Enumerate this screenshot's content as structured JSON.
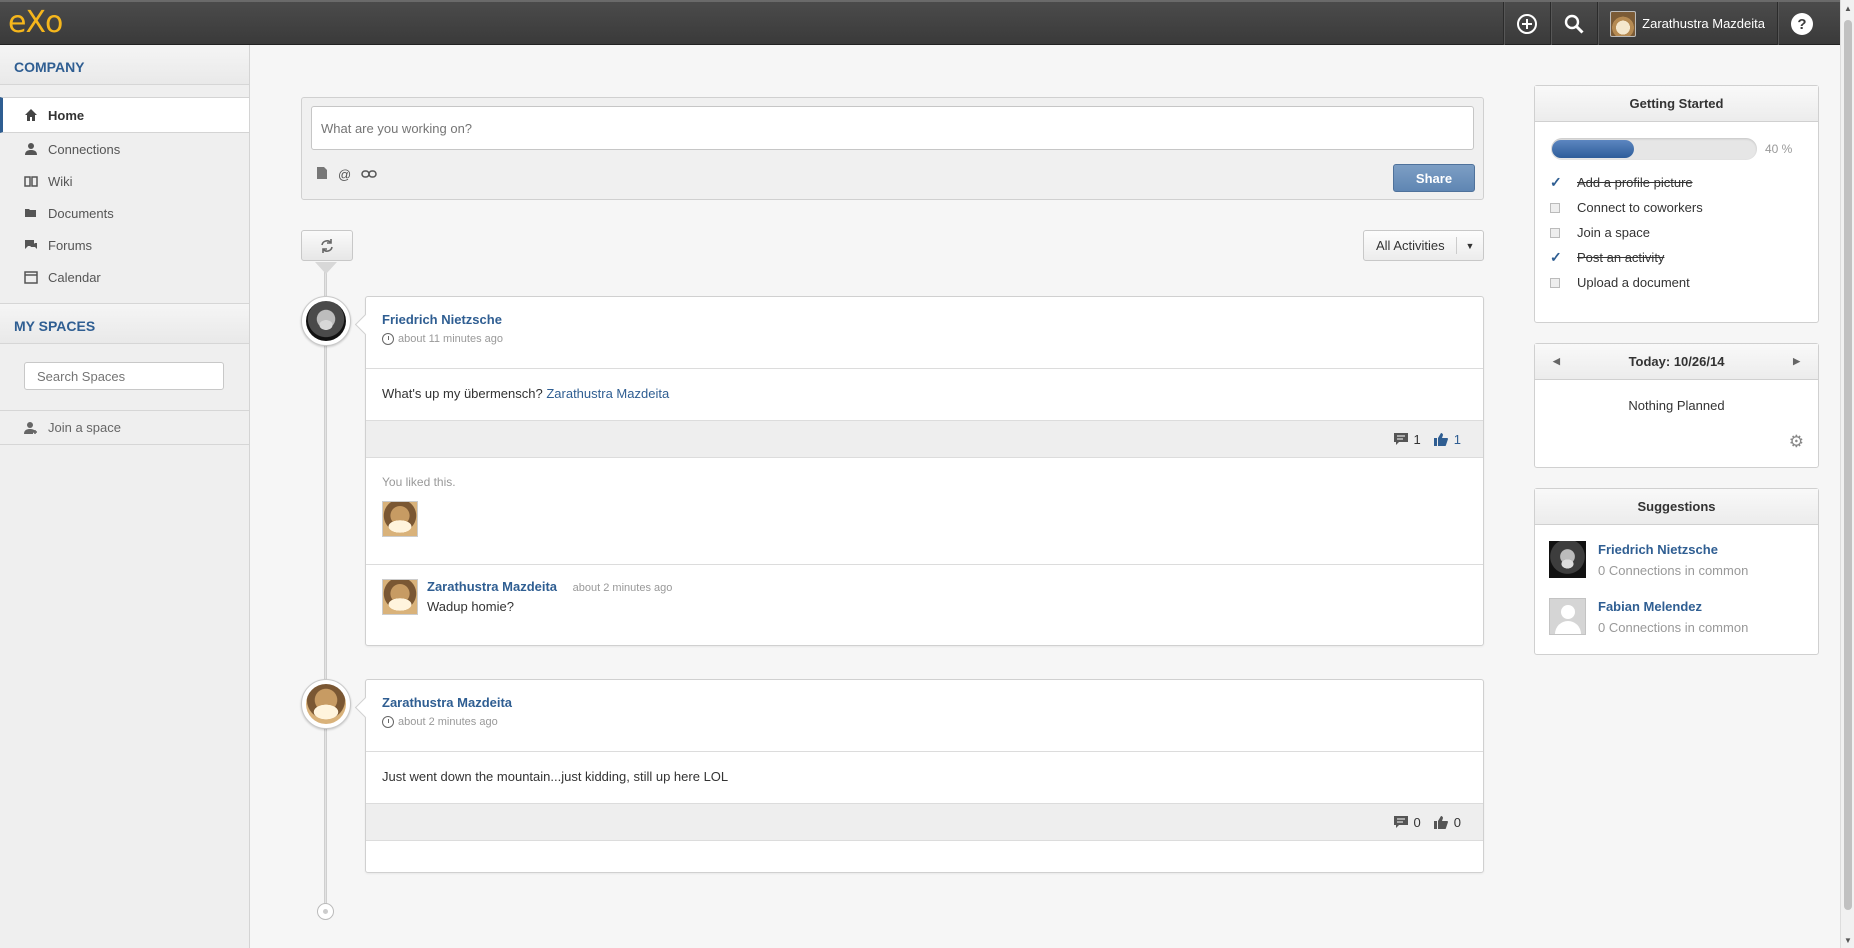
{
  "topbar": {
    "logo": "eXo",
    "user_name": "Zarathustra Mazdeita"
  },
  "sidebar": {
    "company_title": "COMPANY",
    "nav": [
      {
        "label": "Home",
        "icon": "home-icon"
      },
      {
        "label": "Connections",
        "icon": "person-icon"
      },
      {
        "label": "Wiki",
        "icon": "book-icon"
      },
      {
        "label": "Documents",
        "icon": "folder-icon"
      },
      {
        "label": "Forums",
        "icon": "chat-icon"
      },
      {
        "label": "Calendar",
        "icon": "calendar-icon"
      }
    ],
    "spaces_title": "MY SPACES",
    "search_placeholder": "Search Spaces",
    "join_label": "Join a space"
  },
  "composer": {
    "placeholder": "What are you working on?",
    "share_label": "Share"
  },
  "filter": {
    "selected": "All Activities"
  },
  "activities": [
    {
      "author": "Friedrich Nietzsche",
      "time": "about 11 minutes ago",
      "text": "What's up my übermensch?",
      "mention": "Zarathustra Mazdeita",
      "comments_count": "1",
      "likes_count": "1",
      "liked_text": "You liked this.",
      "comment": {
        "author": "Zarathustra Mazdeita",
        "time": "about 2 minutes ago",
        "text": "Wadup homie?"
      }
    },
    {
      "author": "Zarathustra Mazdeita",
      "time": "about 2 minutes ago",
      "text": "Just went down the mountain...just kidding, still up here LOL",
      "comments_count": "0",
      "likes_count": "0"
    }
  ],
  "getting_started": {
    "title": "Getting Started",
    "progress": 0.4,
    "progress_label": "40 %",
    "items": [
      {
        "label": "Add a profile picture",
        "done": true
      },
      {
        "label": "Connect to coworkers",
        "done": false
      },
      {
        "label": "Join a space",
        "done": false
      },
      {
        "label": "Post an activity",
        "done": true
      },
      {
        "label": "Upload a document",
        "done": false
      }
    ]
  },
  "calendar": {
    "title": "Today: 10/26/14",
    "empty_text": "Nothing Planned"
  },
  "suggestions": {
    "title": "Suggestions",
    "people": [
      {
        "name": "Friedrich Nietzsche",
        "common": "0 Connections in common"
      },
      {
        "name": "Fabian Melendez",
        "common": "0 Connections in common"
      }
    ]
  }
}
